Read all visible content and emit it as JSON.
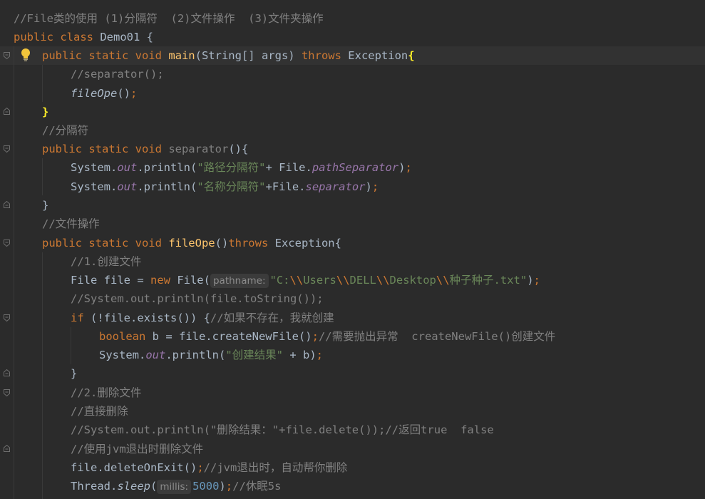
{
  "editor": {
    "lines": [
      [
        [
          "cm",
          "//File类的使用 (1)分隔符  (2)文件操作  (3)文件夹操作"
        ]
      ],
      [
        [
          "kw",
          "public class "
        ],
        [
          "",
          "Demo01 {"
        ]
      ],
      [
        [
          "kw",
          "public static void "
        ],
        [
          "fn",
          "main"
        ],
        [
          "",
          "(String[] args) "
        ],
        [
          "kw",
          "throws "
        ],
        [
          "",
          "Exception"
        ],
        [
          "br",
          "{"
        ]
      ],
      [
        [
          "cm",
          "//separator();"
        ]
      ],
      [
        [
          "it",
          "fileOpe"
        ],
        [
          "",
          "()"
        ],
        [
          "pu",
          ";"
        ]
      ],
      [
        [
          "br",
          "}"
        ]
      ],
      [
        [
          "cm",
          "//分隔符"
        ]
      ],
      [
        [
          "kw",
          "public static void "
        ],
        [
          "cm",
          "separator"
        ],
        [
          "",
          "(){"
        ]
      ],
      [
        [
          "",
          "System."
        ],
        [
          "fi",
          "out"
        ],
        [
          "",
          ".println("
        ],
        [
          "st",
          "\"路径分隔符\""
        ],
        [
          "",
          "+ File."
        ],
        [
          "fi",
          "pathSeparator"
        ],
        [
          "",
          ")"
        ],
        [
          "pu",
          ";"
        ]
      ],
      [
        [
          "",
          "System."
        ],
        [
          "fi",
          "out"
        ],
        [
          "",
          ".println("
        ],
        [
          "st",
          "\"名称分隔符\""
        ],
        [
          "",
          "+File."
        ],
        [
          "fi",
          "separator"
        ],
        [
          "",
          ")"
        ],
        [
          "pu",
          ";"
        ]
      ],
      [
        [
          "",
          "}"
        ]
      ],
      [
        [
          "cm",
          "//文件操作"
        ]
      ],
      [
        [
          "kw",
          "public static void "
        ],
        [
          "fn",
          "fileOpe"
        ],
        [
          "",
          "()"
        ],
        [
          "kw",
          "throws "
        ],
        [
          "",
          "Exception{"
        ]
      ],
      [
        [
          "cm",
          "//1.创建文件"
        ]
      ],
      [
        [
          "",
          "File file = "
        ],
        [
          "kw",
          "new "
        ],
        [
          "",
          "File("
        ],
        [
          "hint",
          "pathname:"
        ],
        [
          "st",
          "\"C:"
        ],
        [
          "pu",
          "\\\\"
        ],
        [
          "st",
          "Users"
        ],
        [
          "pu",
          "\\\\"
        ],
        [
          "st",
          "DELL"
        ],
        [
          "pu",
          "\\\\"
        ],
        [
          "st",
          "Desktop"
        ],
        [
          "pu",
          "\\\\"
        ],
        [
          "st",
          "种子种子.txt\""
        ],
        [
          "",
          ")"
        ],
        [
          "pu",
          ";"
        ]
      ],
      [
        [
          "cm",
          "//System.out.println(file.toString());"
        ]
      ],
      [
        [
          "kw",
          "if "
        ],
        [
          "",
          "(!file.exists()) {"
        ],
        [
          "cm",
          "//如果不存在，我就创建"
        ]
      ],
      [
        [
          "kw",
          "boolean "
        ],
        [
          "",
          "b = file.createNewFile()"
        ],
        [
          "pu",
          ";"
        ],
        [
          "cm",
          "//需要抛出异常  createNewFile()创建文件"
        ]
      ],
      [
        [
          "",
          "System."
        ],
        [
          "fi",
          "out"
        ],
        [
          "",
          ".println("
        ],
        [
          "st",
          "\"创建结果\""
        ],
        [
          "",
          " + b)"
        ],
        [
          "pu",
          ";"
        ]
      ],
      [
        [
          "",
          "}"
        ]
      ],
      [
        [
          "cm",
          "//2.删除文件"
        ]
      ],
      [
        [
          "cm",
          "//直接删除"
        ]
      ],
      [
        [
          "cm",
          "//System.out.println(\"删除结果：\"+file.delete());//返回true  false"
        ]
      ],
      [
        [
          "cm",
          "//使用jvm退出时删除文件"
        ]
      ],
      [
        [
          "",
          "file.deleteOnExit()"
        ],
        [
          "pu",
          ";"
        ],
        [
          "cm",
          "//jvm退出时，自动帮你删除"
        ]
      ],
      [
        [
          "",
          "Thread."
        ],
        [
          "it",
          "sleep"
        ],
        [
          "",
          "("
        ],
        [
          "hint",
          "millis:"
        ],
        [
          "nm",
          "5000"
        ],
        [
          "",
          ")"
        ],
        [
          "pu",
          ";"
        ],
        [
          "cm",
          "//休眠5s"
        ]
      ]
    ]
  },
  "colors": {
    "background": "#2b2b2b",
    "keyword": "#cc7832",
    "comment": "#808080",
    "string": "#6a8759",
    "function": "#ffc66d",
    "field": "#9876aa",
    "number": "#6897bb",
    "brace_match": "#ffef28"
  },
  "icons": {
    "intention": "lightbulb-icon",
    "fold": "fold-marker-icon"
  }
}
